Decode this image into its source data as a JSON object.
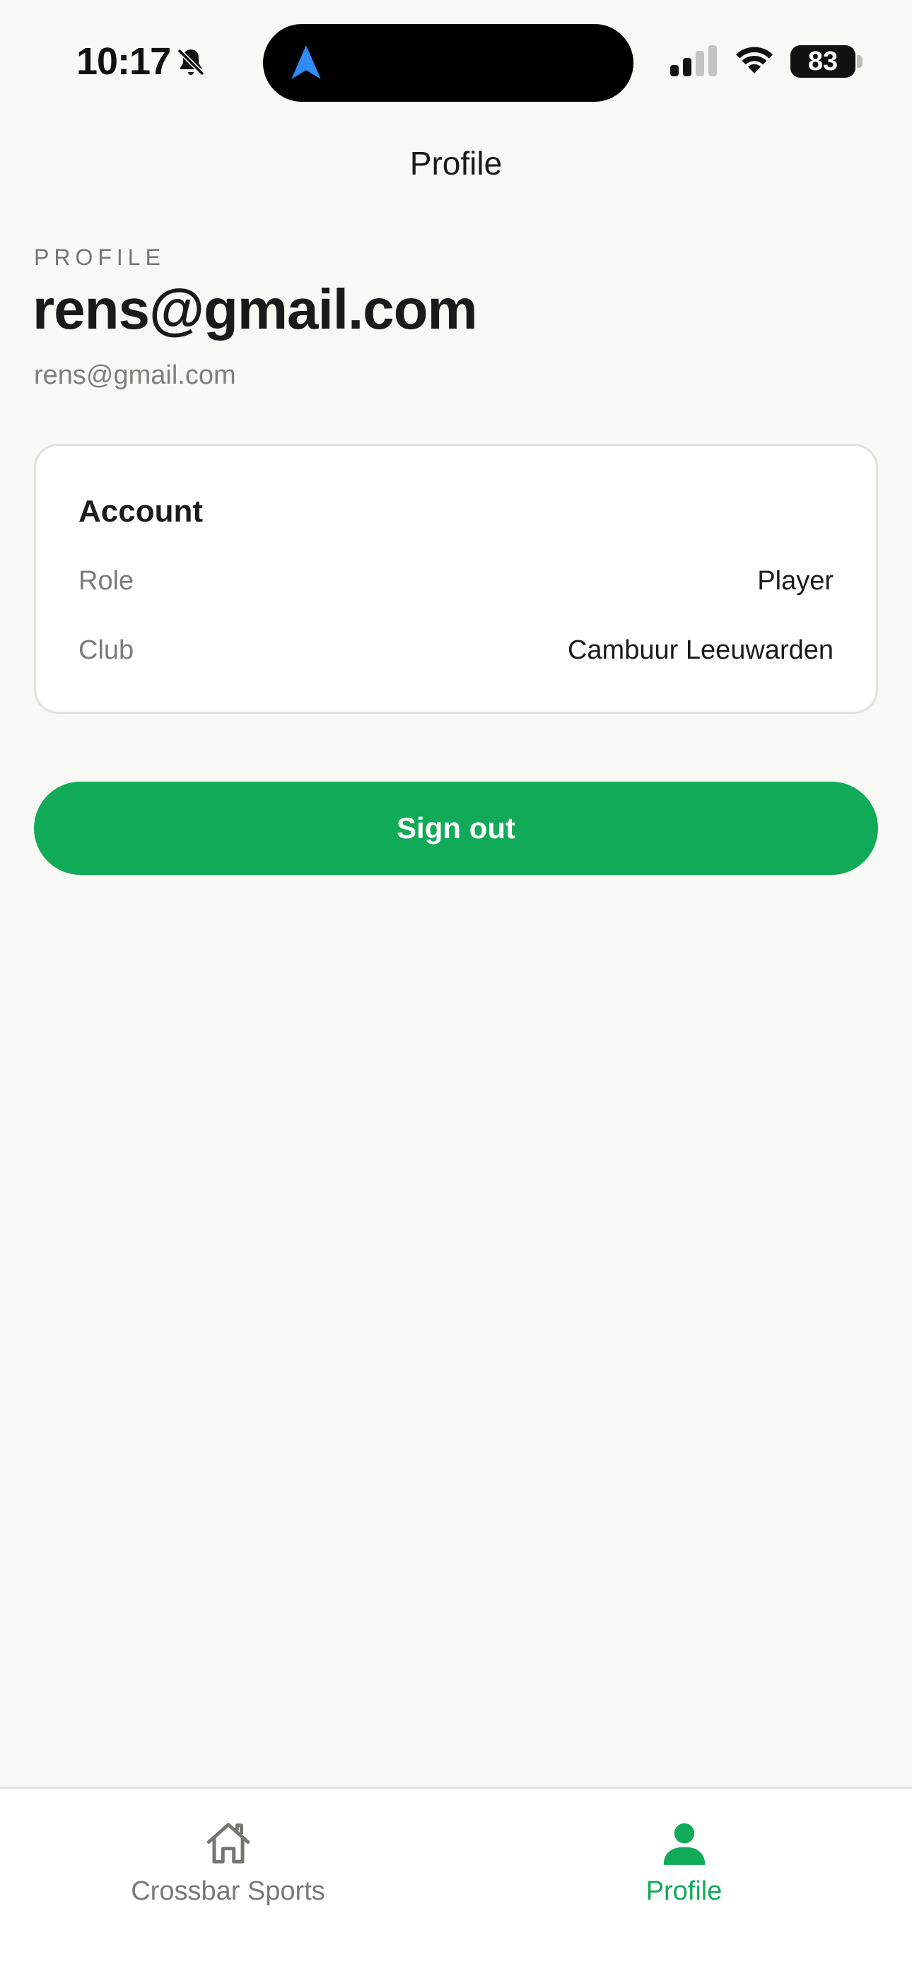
{
  "status_bar": {
    "time": "10:17",
    "battery": "83",
    "icons": [
      "bell-off-icon",
      "navigation-arrow-icon",
      "cellular-signal-icon",
      "wifi-icon",
      "battery-icon"
    ]
  },
  "header": {
    "title": "Profile"
  },
  "profile": {
    "eyebrow": "PROFILE",
    "name": "rens@gmail.com",
    "email": "rens@gmail.com"
  },
  "account_card": {
    "title": "Account",
    "rows": [
      {
        "label": "Role",
        "value": "Player"
      },
      {
        "label": "Club",
        "value": "Cambuur Leeuwarden"
      }
    ]
  },
  "actions": {
    "sign_out_label": "Sign out"
  },
  "tab_bar": {
    "tabs": [
      {
        "label": "Crossbar Sports",
        "icon": "home-icon",
        "active": false
      },
      {
        "label": "Profile",
        "icon": "person-icon",
        "active": true
      }
    ]
  },
  "colors": {
    "accent": "#10AA58",
    "background": "#F8F8F4",
    "card_border": "#E1E1D9",
    "muted_text": "#7C7C76"
  }
}
